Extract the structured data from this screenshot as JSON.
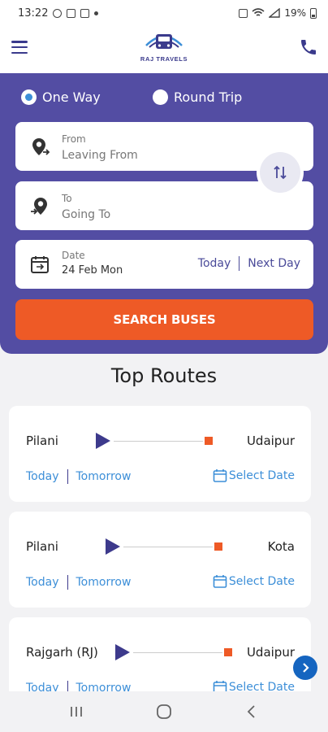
{
  "status_bar": {
    "time": "13:22",
    "battery": "19%"
  },
  "header": {
    "logo_text": "RAJ TRAVELS"
  },
  "search": {
    "trip_types": [
      "One Way",
      "Round Trip"
    ],
    "selected_trip": "One Way",
    "from": {
      "label": "From",
      "placeholder": "Leaving From"
    },
    "to": {
      "label": "To",
      "placeholder": "Going To"
    },
    "date": {
      "label": "Date",
      "value": "24 Feb Mon",
      "today": "Today",
      "next_day": "Next Day"
    },
    "button": "SEARCH BUSES"
  },
  "top_routes": {
    "title": "Top Routes",
    "routes": [
      {
        "from": "Pilani",
        "to": "Udaipur",
        "today": "Today",
        "tomorrow": "Tomorrow",
        "select_date": "Select Date"
      },
      {
        "from": "Pilani",
        "to": "Kota",
        "today": "Today",
        "tomorrow": "Tomorrow",
        "select_date": "Select Date"
      },
      {
        "from": "Rajgarh (RJ)",
        "to": "Udaipur",
        "today": "Today",
        "tomorrow": "Tomorrow",
        "select_date": "Select Date"
      }
    ]
  },
  "colors": {
    "brand": "#534da3",
    "accent": "#ee5a26",
    "link": "#3d8fd8",
    "fab": "#1565c0"
  },
  "icons": {
    "menu": "hamburger-icon",
    "phone": "phone-icon",
    "from": "location-pin-from-icon",
    "to": "location-pin-to-icon",
    "date": "calendar-swap-icon",
    "swap": "swap-icon",
    "calendar": "calendar-icon",
    "fab": "chevron-right-icon"
  }
}
